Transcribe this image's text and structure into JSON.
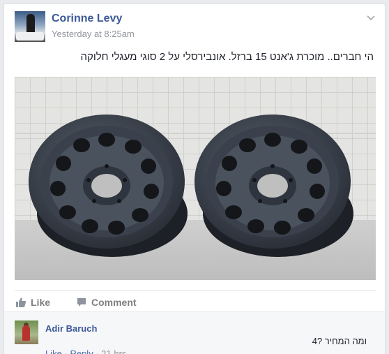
{
  "post": {
    "author": "Corinne Levy",
    "timestamp": "Yesterday at 8:25am",
    "text": "הי חברים.. מוכרת ג'אנט 15 ברזל. אונבירסלי על 2 סוגי מעגלי חלוקה",
    "photo_description_icon": "photo-two-black-steel-wheel-rims"
  },
  "actions": {
    "like_label": "Like",
    "comment_label": "Comment"
  },
  "comment": {
    "author": "Adir Baruch",
    "text": "ומה המחיר ?4",
    "like_label": "Like",
    "reply_label": "Reply",
    "time": "21 hrs",
    "separator": "·"
  },
  "colors": {
    "link_blue": "#3b5998",
    "meta_gray": "#90949c",
    "page_bg": "#e9ebee"
  }
}
